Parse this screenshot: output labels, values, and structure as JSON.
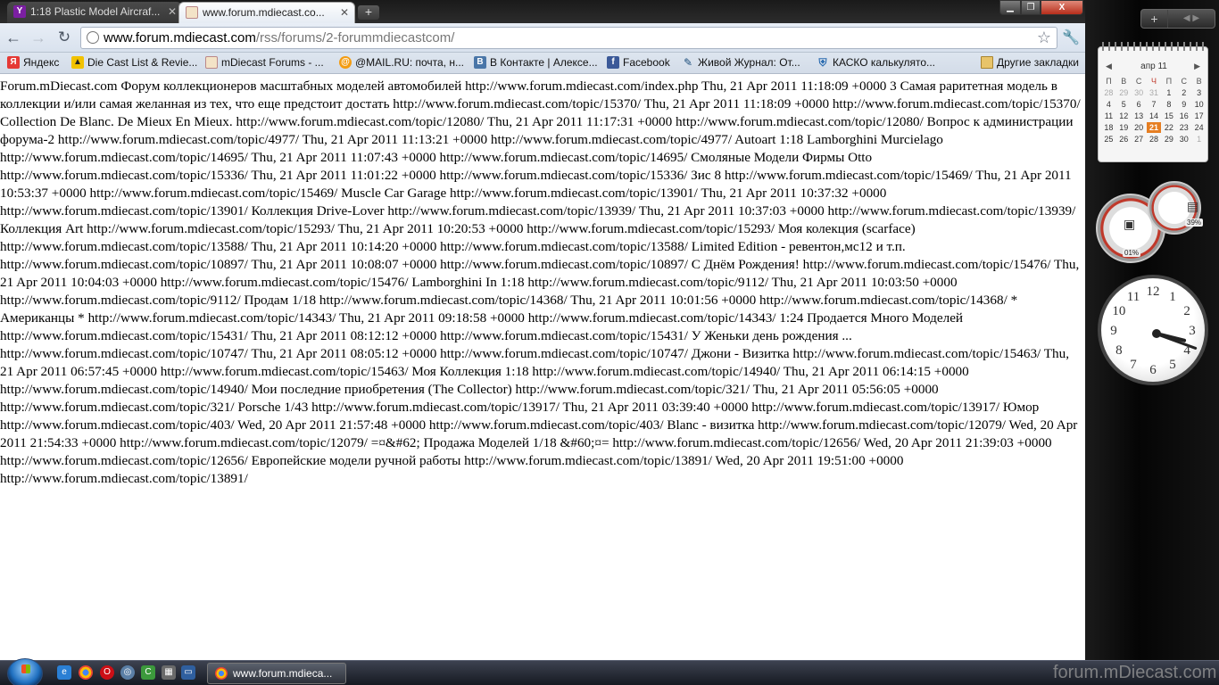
{
  "tabs": [
    {
      "label": "1:18 Plastic Model Aircraf...",
      "active": false,
      "icon": "yahoo-icon"
    },
    {
      "label": "www.forum.mdiecast.co...",
      "active": true,
      "icon": "mdiecast-icon"
    }
  ],
  "window": {
    "close_glyph": "X"
  },
  "address_bar": {
    "host": "www.forum.mdiecast.com",
    "path": "/rss/forums/2-forummdiecastcom/"
  },
  "bookmarks": [
    {
      "label": "Яндекс",
      "icon": "yandex-icon"
    },
    {
      "label": "Die Cast List & Revie...",
      "icon": "diecast-list-icon"
    },
    {
      "label": "mDiecast Forums - ...",
      "icon": "mdiecast-icon"
    },
    {
      "label": "@MAIL.RU: почта, н...",
      "icon": "mailru-icon"
    },
    {
      "label": "В Контакте | Алексе...",
      "icon": "vk-icon"
    },
    {
      "label": "Facebook",
      "icon": "facebook-icon"
    },
    {
      "label": "Живой Журнал: От...",
      "icon": "livejournal-icon"
    },
    {
      "label": "КАСКО калькулято...",
      "icon": "kasko-icon"
    },
    {
      "label": "Другие закладки",
      "icon": "folder-icon"
    }
  ],
  "page": {
    "rss_text": "Forum.mDiecast.com Форум коллекционеров масштабных моделей автомобилей http://www.forum.mdiecast.com/index.php Thu, 21 Apr 2011 11:18:09 +0000 3 Самая раритетная модель в коллекции и/или самая желанная из тех, что еще предстоит достать http://www.forum.mdiecast.com/topic/15370/ Thu, 21 Apr 2011 11:18:09 +0000 http://www.forum.mdiecast.com/topic/15370/ Collection De Blanc. De Mieux En Mieux. http://www.forum.mdiecast.com/topic/12080/ Thu, 21 Apr 2011 11:17:31 +0000 http://www.forum.mdiecast.com/topic/12080/ Вопрос к администрации форума-2 http://www.forum.mdiecast.com/topic/4977/ Thu, 21 Apr 2011 11:13:21 +0000 http://www.forum.mdiecast.com/topic/4977/ Autoart 1:18 Lamborghini Murcielago http://www.forum.mdiecast.com/topic/14695/ Thu, 21 Apr 2011 11:07:43 +0000 http://www.forum.mdiecast.com/topic/14695/ Смоляные Модели Фирмы Otto http://www.forum.mdiecast.com/topic/15336/ Thu, 21 Apr 2011 11:01:22 +0000 http://www.forum.mdiecast.com/topic/15336/ Зис 8 http://www.forum.mdiecast.com/topic/15469/ Thu, 21 Apr 2011 10:53:37 +0000 http://www.forum.mdiecast.com/topic/15469/ Muscle Car Garage http://www.forum.mdiecast.com/topic/13901/ Thu, 21 Apr 2011 10:37:32 +0000 http://www.forum.mdiecast.com/topic/13901/ Коллекция Drive-Lover http://www.forum.mdiecast.com/topic/13939/ Thu, 21 Apr 2011 10:37:03 +0000 http://www.forum.mdiecast.com/topic/13939/ Коллекция Art http://www.forum.mdiecast.com/topic/15293/ Thu, 21 Apr 2011 10:20:53 +0000 http://www.forum.mdiecast.com/topic/15293/ Моя колекция (scarface) http://www.forum.mdiecast.com/topic/13588/ Thu, 21 Apr 2011 10:14:20 +0000 http://www.forum.mdiecast.com/topic/13588/ Limited Edition - ревентон,мс12 и т.п. http://www.forum.mdiecast.com/topic/10897/ Thu, 21 Apr 2011 10:08:07 +0000 http://www.forum.mdiecast.com/topic/10897/ С Днём Рождения! http://www.forum.mdiecast.com/topic/15476/ Thu, 21 Apr 2011 10:04:03 +0000 http://www.forum.mdiecast.com/topic/15476/ Lamborghini In 1:18 http://www.forum.mdiecast.com/topic/9112/ Thu, 21 Apr 2011 10:03:50 +0000 http://www.forum.mdiecast.com/topic/9112/ Продам 1/18 http://www.forum.mdiecast.com/topic/14368/ Thu, 21 Apr 2011 10:01:56 +0000 http://www.forum.mdiecast.com/topic/14368/ * Американцы * http://www.forum.mdiecast.com/topic/14343/ Thu, 21 Apr 2011 09:18:58 +0000 http://www.forum.mdiecast.com/topic/14343/ 1:24 Продается Много Моделей http://www.forum.mdiecast.com/topic/15431/ Thu, 21 Apr 2011 08:12:12 +0000 http://www.forum.mdiecast.com/topic/15431/ У Женьки день рождения ... http://www.forum.mdiecast.com/topic/10747/ Thu, 21 Apr 2011 08:05:12 +0000 http://www.forum.mdiecast.com/topic/10747/ Джони - Визитка http://www.forum.mdiecast.com/topic/15463/ Thu, 21 Apr 2011 06:57:45 +0000 http://www.forum.mdiecast.com/topic/15463/ Моя Коллекция 1:18 http://www.forum.mdiecast.com/topic/14940/ Thu, 21 Apr 2011 06:14:15 +0000 http://www.forum.mdiecast.com/topic/14940/ Мои последние приобретения (The Collector) http://www.forum.mdiecast.com/topic/321/ Thu, 21 Apr 2011 05:56:05 +0000 http://www.forum.mdiecast.com/topic/321/ Porsche 1/43 http://www.forum.mdiecast.com/topic/13917/ Thu, 21 Apr 2011 03:39:40 +0000 http://www.forum.mdiecast.com/topic/13917/ Юмор http://www.forum.mdiecast.com/topic/403/ Wed, 20 Apr 2011 21:57:48 +0000 http://www.forum.mdiecast.com/topic/403/ Blanc - визитка http://www.forum.mdiecast.com/topic/12079/ Wed, 20 Apr 2011 21:54:33 +0000 http://www.forum.mdiecast.com/topic/12079/ =¤&#62; Продажа Моделей 1/18 &#60;¤= http://www.forum.mdiecast.com/topic/12656/ Wed, 20 Apr 2011 21:39:03 +0000 http://www.forum.mdiecast.com/topic/12656/ Европейские модели ручной работы http://www.forum.mdiecast.com/topic/13891/ Wed, 20 Apr 2011 19:51:00 +0000 http://www.forum.mdiecast.com/topic/13891/"
  },
  "calendar": {
    "month_label": "апр 11",
    "weekdays": [
      "П",
      "В",
      "С",
      "Ч",
      "П",
      "С",
      "В"
    ],
    "days": [
      "28",
      "29",
      "30",
      "31",
      "1",
      "2",
      "3",
      "4",
      "5",
      "6",
      "7",
      "8",
      "9",
      "10",
      "11",
      "12",
      "13",
      "14",
      "15",
      "16",
      "17",
      "18",
      "19",
      "20",
      "21",
      "22",
      "23",
      "24",
      "25",
      "26",
      "27",
      "28",
      "29",
      "30",
      "1"
    ],
    "today": "21"
  },
  "meters": {
    "cpu": "01%",
    "ram": "39%"
  },
  "clock": {
    "numbers": [
      "12",
      "1",
      "2",
      "3",
      "4",
      "5",
      "6",
      "7",
      "8",
      "9",
      "10",
      "11"
    ]
  },
  "taskbar": {
    "active_window": "www.forum.mdieca...",
    "watermark": "forum.mDiecast.com"
  },
  "colors": {
    "today_highlight": "#e67e22",
    "window_close": "#c0392b"
  }
}
